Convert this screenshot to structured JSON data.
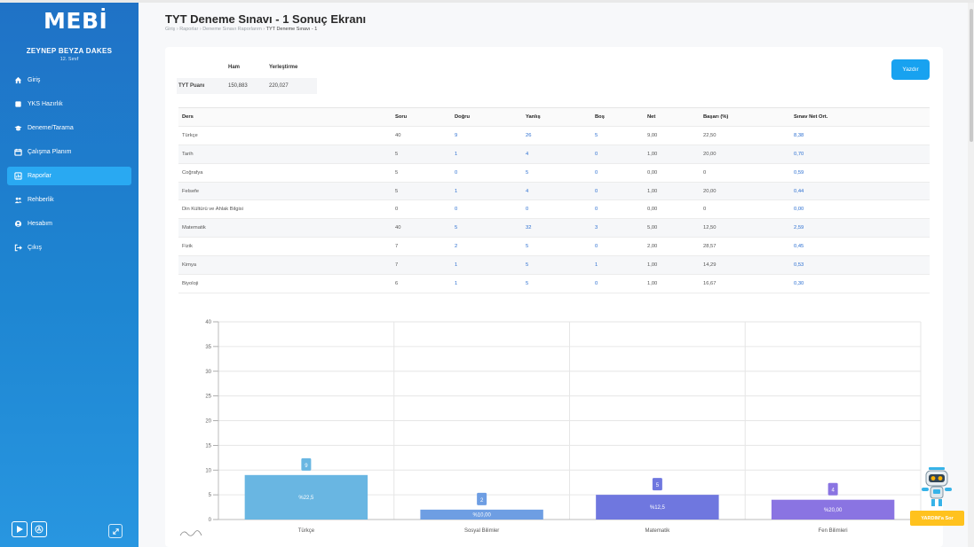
{
  "app": {
    "logo": "MEBİ"
  },
  "user": {
    "name": "ZEYNEP BEYZA DAKES",
    "class": "12. Sınıf"
  },
  "sidebar": {
    "items": [
      {
        "label": "Giriş",
        "icon": "home-icon",
        "active": false
      },
      {
        "label": "YKS Hazırlık",
        "icon": "book-icon",
        "active": false
      },
      {
        "label": "Deneme/Tarama",
        "icon": "graduation-cap-icon",
        "active": false
      },
      {
        "label": "Çalışma Planım",
        "icon": "calendar-icon",
        "active": false
      },
      {
        "label": "Raporlar",
        "icon": "report-icon",
        "active": true
      },
      {
        "label": "Rehberlik",
        "icon": "users-icon",
        "active": false
      },
      {
        "label": "Hesabım",
        "icon": "user-icon",
        "active": false
      },
      {
        "label": "Çıkış",
        "icon": "logout-icon",
        "active": false
      }
    ]
  },
  "page": {
    "title": "TYT Deneme Sınavı - 1 Sonuç Ekranı",
    "breadcrumb": [
      "Giriş",
      "Raporlar",
      "Deneme Sınavı Raporlarım",
      "TYT Deneme Sınavı - 1"
    ],
    "print_label": "Yazdır"
  },
  "summary": {
    "headers": [
      "Ham",
      "Yerleştirme"
    ],
    "row_label": "TYT Puanı",
    "values": [
      "150,883",
      "220,027"
    ]
  },
  "results_table": {
    "columns": [
      "Ders",
      "Soru",
      "Doğru",
      "Yanlış",
      "Boş",
      "Net",
      "Başarı (%)",
      "Sınav Net Ort."
    ],
    "rows": [
      [
        "Türkçe",
        "40",
        "9",
        "26",
        "5",
        "9,00",
        "22,50",
        "8,38"
      ],
      [
        "Tarih",
        "5",
        "1",
        "4",
        "0",
        "1,00",
        "20,00",
        "0,70"
      ],
      [
        "Coğrafya",
        "5",
        "0",
        "5",
        "0",
        "0,00",
        "0",
        "0,59"
      ],
      [
        "Felsefe",
        "5",
        "1",
        "4",
        "0",
        "1,00",
        "20,00",
        "0,44"
      ],
      [
        "Din Kültürü ve Ahlak Bilgisi",
        "0",
        "0",
        "0",
        "0",
        "0,00",
        "0",
        "0,00"
      ],
      [
        "Matematik",
        "40",
        "5",
        "32",
        "3",
        "5,00",
        "12,50",
        "2,59"
      ],
      [
        "Fizik",
        "7",
        "2",
        "5",
        "0",
        "2,00",
        "28,57",
        "0,45"
      ],
      [
        "Kimya",
        "7",
        "1",
        "5",
        "1",
        "1,00",
        "14,29",
        "0,53"
      ],
      [
        "Biyoloji",
        "6",
        "1",
        "5",
        "0",
        "1,00",
        "16,67",
        "0,30"
      ]
    ]
  },
  "chart_data": {
    "type": "bar",
    "categories": [
      "Türkçe",
      "Sosyal Bilimler",
      "Matematik",
      "Fen Bilimleri"
    ],
    "values": [
      9,
      2,
      5,
      4
    ],
    "bar_labels": [
      "9",
      "2",
      "5",
      "4"
    ],
    "inner_labels": [
      "%22,5",
      "%10,00",
      "%12,5",
      "%20,00"
    ],
    "colors": [
      "#69b6e2",
      "#6e9ee3",
      "#6f77df",
      "#8a74e2"
    ],
    "yticks": [
      0,
      5,
      10,
      15,
      20,
      25,
      30,
      35,
      40
    ],
    "ylim": [
      0,
      40
    ],
    "grid": true
  },
  "assistant": {
    "button_label": "YARDIM'a Sor"
  }
}
